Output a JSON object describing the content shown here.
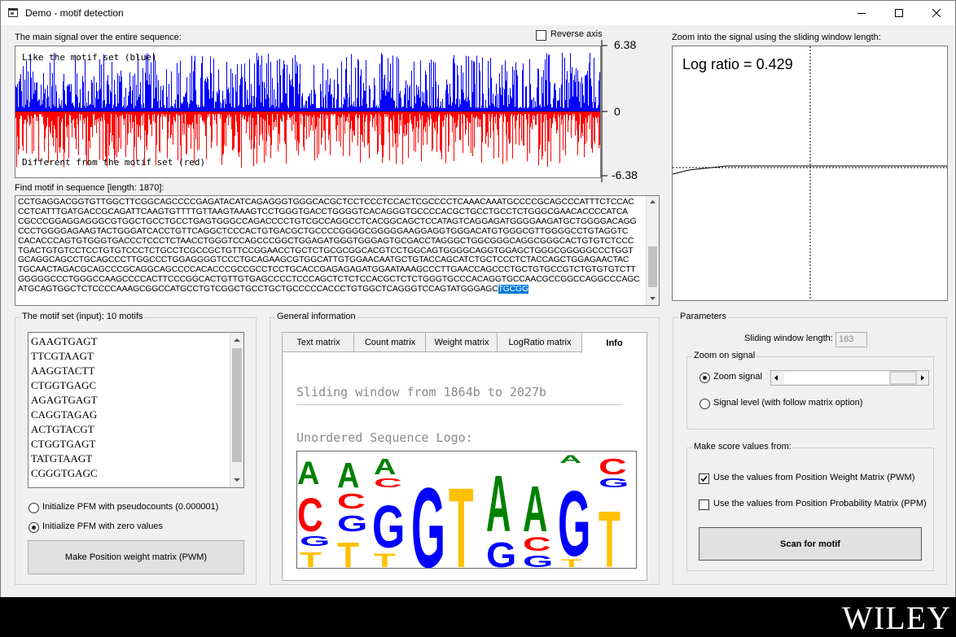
{
  "window": {
    "title": "Demo - motif detection"
  },
  "signal_plot": {
    "label": "The main signal over the entire sequence:",
    "reverse_axis_label": "Reverse axis",
    "reverse_axis_checked": false,
    "top_text": "Like the motif set (blue)",
    "bottom_text": "Different from the motif set (red)",
    "y_max": "6.38",
    "y_zero": "0",
    "y_min": "-6.38",
    "positive_color": "#0000ff",
    "negative_color": "#ff0000"
  },
  "zoom_plot": {
    "label": "Zoom into the signal using the sliding window length:",
    "log_ratio_text": "Log ratio = 0.429"
  },
  "sequence": {
    "label": "Find motif in sequence [length: 1870]:",
    "lines": [
      "CCTGAGGACGGTGTTGGCTTCGGCAGCCCCGAGATACATCAGAGGGTGGGCACGCTCCTCCCTCCACTCGCCCCTCAAACAAATGCCCCGCAGCCCATTTCTCCAC",
      "CCTCATTTGATGACCGCAGATTCAAGTGTTTTGTTAAGTAAAGTCCTGGGTGACCTGGGGTCACAGGGTGCCCCACGCTGCCTGCCTCTGGGCGAACACCCCATCA",
      "CGCCCGGAGGAGGGCGTGGCTGCCTGCCTGAGTGGGCCAGACCCCTGTCGCCAGGCCTCACGGCAGCTCCATAGTCAGGAGATGGGGAAGATGCTGGGGACAGG",
      "CCCTGGGGAGAAGTACTGGGATCACCTGTTCAGGCTCCCACTGTGACGCTGCCCCGGGGCGGGGGAAGGAGGTGGGACATGTGGGCGTTGGGGCCTGTAGGTC",
      "CACACCCAGTGTGGGTGACCCTCCCTCTAACCTGGGTCCAGCCCGGCTGGAGATGGGTGGGAGTGCGACCTAGGGCTGGCGGGCAGGCGGGCACTGTGTCTCCC",
      "TGACTGTGTCCTCCTGTGTCCCTCTGCCTCGCCGCTGTTCCGGAACCTGCTCTGCGCGGCACGTCCTGGCAGTGGGGCAGGTGGAGCTGGGCGGGGGCCCTGGT",
      "GCAGGCAGCCTGCAGCCCTTGGCCCTGGAGGGGTCCCTGCAGAAGCGTGGCATTGTGGAACAATGCTGTACCAGCATCTGCTCCCTCTACCAGCTGGAGAACTAC",
      "TGCAACTAGACGCAGCCCGCAGGCAGCCCCACACCCGCCGCCTCCTGCACCGAGAGAGATGGAATAAAGCCCTTGAACCAGCCCTGCTGTGCCGTCTGTGTGTCTT",
      "GGGGGCCCTGGGCCAAGCCCCACTTCCCGGCACTGTTGTGAGCCCCTCCCAGCTCTCTCCACGCTCTCTGGGTGCCCACAGGTGCCAACGCCGGCCAGGCCCAGC",
      "ATGCAGTGGCTCTCCCCAAAGCGGCCATGCCTGTCGGCTGCCTGCTGCCCCCACCCTGTGGCTCAGGGTCCAGTATGGGAGC"
    ],
    "selected_tail": "TGCGG"
  },
  "motif_set": {
    "label": "The motif set (input): 10 motifs",
    "motifs": [
      "GAAGTGAGT",
      "TTCGTAAGT",
      "AAGGTACTT",
      "CTGGTGAGC",
      "AGAGTGAGT",
      "CAGGTAGAG",
      "ACTGTACGT",
      "CTGGTGAGT",
      "TATGTAAGT",
      "CGGGTGAGC"
    ],
    "init_pseudo_label": "Initialize PFM with pseudocounts (0.000001)",
    "init_zero_label": "Initialize PFM with zero values",
    "selected_init": "zero",
    "make_pwm_button": "Make Position weight matrix (PWM)"
  },
  "general_info": {
    "label": "General information",
    "tabs": [
      "Text matrix",
      "Count matrix",
      "Weight matrix",
      "LogRatio matrix",
      "Info"
    ],
    "active_tab": "Info",
    "window_text": "Sliding window from 1864b to 2027b",
    "logo_title": "Unordered Sequence Logo:",
    "logo_colors": {
      "A": "#008000",
      "C": "#ff0000",
      "G": "#0000ff",
      "T": "#ffc000"
    }
  },
  "parameters": {
    "label": "Parameters",
    "sliding_label": "Sliding window length:",
    "sliding_value": "163",
    "zoom_group_label": "Zoom on signal",
    "zoom_signal_label": "Zoom signal",
    "signal_level_label": "Signal level (with follow matrix option)",
    "selected_zoom": "zoom",
    "score_group_label": "Make score values from:",
    "pwm_label": "Use the values from Position Weight Matrix (PWM)",
    "pwm_checked": true,
    "ppm_label": "Use the values from Position Probability Matrix (PPM)",
    "ppm_checked": false,
    "scan_button": "Scan for motif"
  },
  "brand": {
    "wiley": "WILEY"
  }
}
